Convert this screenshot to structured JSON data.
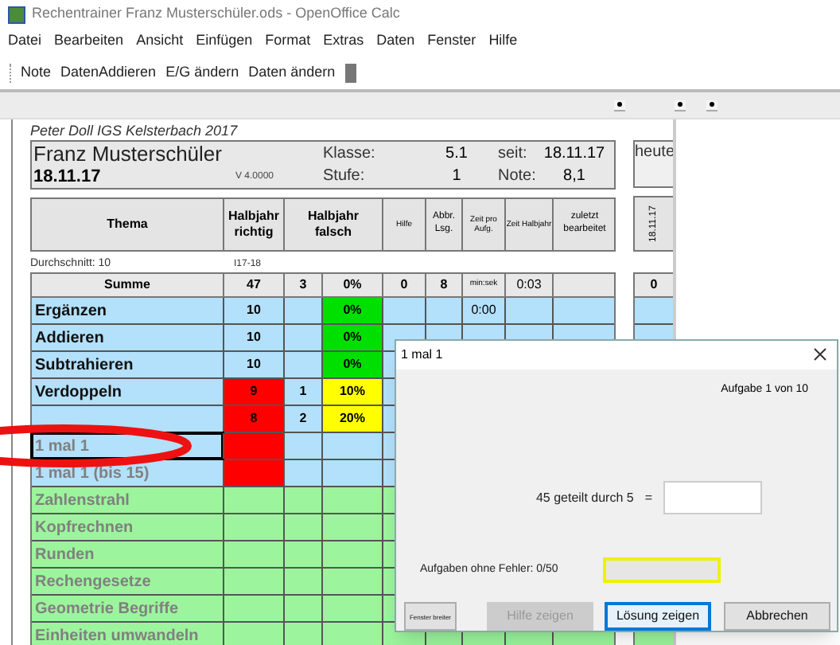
{
  "window": {
    "title": "Rechentrainer Franz Musterschüler.ods - OpenOffice Calc"
  },
  "menu": [
    "Datei",
    "Bearbeiten",
    "Ansicht",
    "Einfügen",
    "Format",
    "Extras",
    "Daten",
    "Fenster",
    "Hilfe"
  ],
  "toolbar": [
    "Note",
    "DatenAddieren",
    "E/G ändern",
    "Daten ändern"
  ],
  "sheet": {
    "author": "Peter Doll IGS Kelsterbach 2017",
    "student": "Franz Musterschüler",
    "date": "18.11.17",
    "version": "V 4.0000",
    "info": [
      {
        "label": "Klasse:",
        "value": "5.1"
      },
      {
        "label": "Stufe:",
        "value": "1"
      }
    ],
    "info2": [
      {
        "label": "seit:",
        "value": "18.11.17"
      },
      {
        "label": "Note:",
        "value": "8,1"
      }
    ],
    "heute": "heute",
    "columns": [
      "Thema",
      "Halbjahr richtig",
      "Halbjahr falsch",
      "Hilfe",
      "Abbr. Lsg.",
      "Zeit pro Aufg.",
      "Zeit Halbjahr",
      "zuletzt bearbeitet"
    ],
    "side_column": "18.11.17",
    "average": "Durchschnitt: 10",
    "period": "I17-18",
    "summary": {
      "label": "Summe",
      "richtig": "47",
      "falsch": "3",
      "falsch_pct": "0%",
      "hilfe": "0",
      "abbr": "8",
      "zeit_pro": "min:sek",
      "zeit_halbjahr": "0:03",
      "side": "0"
    },
    "rows": [
      {
        "thema": "Ergänzen",
        "active": true,
        "color": "#b3e0fb",
        "richtig": {
          "text": "10"
        },
        "falsch_pct": {
          "text": "0%",
          "color": "#00e000"
        },
        "zeit_pro": "0:00",
        "selected": false
      },
      {
        "thema": "Addieren",
        "active": true,
        "color": "#b3e0fb",
        "richtig": {
          "text": "10"
        },
        "falsch_pct": {
          "text": "0%",
          "color": "#00e000"
        },
        "selected": false
      },
      {
        "thema": "Subtrahieren",
        "active": true,
        "color": "#b3e0fb",
        "richtig": {
          "text": "10"
        },
        "falsch_pct": {
          "text": "0%",
          "color": "#00e000"
        },
        "selected": false
      },
      {
        "thema": "Verdoppeln",
        "active": true,
        "color": "#b3e0fb",
        "richtig": {
          "text": "9",
          "color": "#ff0000"
        },
        "falsch": "1",
        "falsch_pct": {
          "text": "10%",
          "color": "#ffff00"
        },
        "selected": false
      },
      {
        "color": "#b3e0fb",
        "richtig": {
          "text": "8",
          "color": "#ff0000"
        },
        "falsch": "2",
        "falsch_pct": {
          "text": "20%",
          "color": "#ffff00"
        },
        "selected": false
      },
      {
        "thema": "1 mal 1",
        "active": false,
        "color": "#b3e0fb",
        "richtig": {
          "color": "#ff0000"
        },
        "selected": true
      },
      {
        "thema": "1 mal 1 (bis 15)",
        "active": false,
        "color": "#b3e0fb",
        "richtig": {
          "color": "#ff0000"
        },
        "selected": false
      },
      {
        "thema": "Zahlenstrahl",
        "active": false,
        "color": "#9cf59c",
        "selected": false
      },
      {
        "thema": "Kopfrechnen",
        "active": false,
        "color": "#9cf59c",
        "selected": false
      },
      {
        "thema": "Runden",
        "active": false,
        "color": "#9cf59c",
        "selected": false
      },
      {
        "thema": "Rechengesetze",
        "active": false,
        "color": "#9cf59c",
        "selected": false
      },
      {
        "thema": "Geometrie Begriffe",
        "active": false,
        "color": "#9cf59c",
        "selected": false
      },
      {
        "thema": "Einheiten umwandeln",
        "active": false,
        "color": "#9cf59c",
        "selected": false
      }
    ]
  },
  "dialog": {
    "title": "1 mal 1",
    "progress": "Aufgabe 1 von 10",
    "question": "45 geteilt durch 5",
    "equals": "=",
    "streak": "Aufgaben ohne Fehler: 0/50",
    "buttons": [
      {
        "label": "Fenster breiter",
        "kind": "small",
        "disabled": false,
        "focused": false
      },
      {
        "label": "Hilfe zeigen",
        "kind": "normal",
        "disabled": true,
        "focused": false
      },
      {
        "label": "Lösung zeigen",
        "kind": "normal",
        "disabled": false,
        "focused": true
      },
      {
        "label": "Abbrechen",
        "kind": "normal",
        "disabled": false,
        "focused": false
      }
    ]
  }
}
